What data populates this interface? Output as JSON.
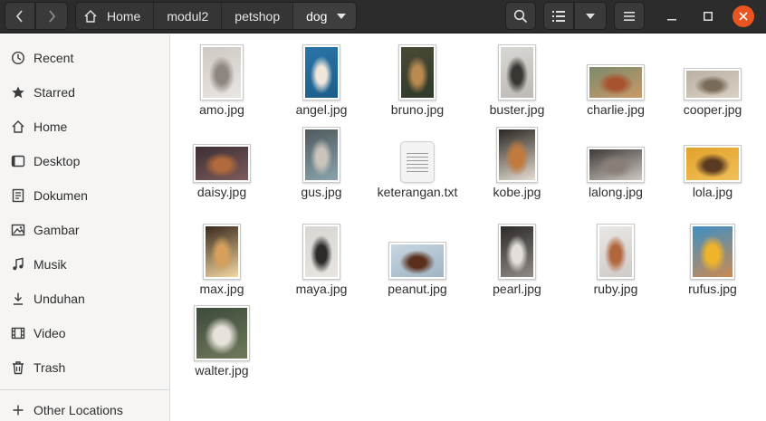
{
  "header": {
    "breadcrumbs": [
      "Home",
      "modul2",
      "petshop",
      "dog"
    ],
    "icons": {
      "back": "chevron-left-icon",
      "forward": "chevron-right-icon",
      "home": "home-icon",
      "dropdown": "chevron-down-icon",
      "search": "search-icon",
      "view": "list-view-icon",
      "menu": "hamburger-menu-icon",
      "minimize": "minimize-icon",
      "maximize": "maximize-icon",
      "close": "close-icon"
    },
    "close_color": "#e95420"
  },
  "sidebar": {
    "items": [
      {
        "label": "Recent",
        "icon": "clock-icon"
      },
      {
        "label": "Starred",
        "icon": "star-icon"
      },
      {
        "label": "Home",
        "icon": "home-icon"
      },
      {
        "label": "Desktop",
        "icon": "desktop-icon"
      },
      {
        "label": "Dokumen",
        "icon": "document-icon"
      },
      {
        "label": "Gambar",
        "icon": "image-icon"
      },
      {
        "label": "Musik",
        "icon": "music-icon"
      },
      {
        "label": "Unduhan",
        "icon": "download-icon"
      },
      {
        "label": "Video",
        "icon": "film-icon"
      },
      {
        "label": "Trash",
        "icon": "trash-icon"
      }
    ],
    "other_locations": {
      "label": "Other Locations",
      "icon": "plus-icon"
    }
  },
  "files": [
    {
      "name": "amo.jpg",
      "icon": "image-thumbnail",
      "colors": [
        "#cfc9c3",
        "#8e8580",
        "#eae6e2"
      ]
    },
    {
      "name": "angel.jpg",
      "icon": "image-thumbnail",
      "colors": [
        "#2a75a8",
        "#efe7dc",
        "#1c5d8a"
      ]
    },
    {
      "name": "bruno.jpg",
      "icon": "image-thumbnail",
      "colors": [
        "#4a4a36",
        "#b98a4f",
        "#2f3a2a"
      ]
    },
    {
      "name": "buster.jpg",
      "icon": "image-thumbnail",
      "colors": [
        "#d9d7d4",
        "#3a3634",
        "#bdb9b4"
      ]
    },
    {
      "name": "charlie.jpg",
      "icon": "image-thumbnail",
      "colors": [
        "#7b8a6b",
        "#a7532f",
        "#c99a6a"
      ]
    },
    {
      "name": "cooper.jpg",
      "icon": "image-thumbnail",
      "colors": [
        "#b9b1a3",
        "#7a6a58",
        "#d8d1c5"
      ]
    },
    {
      "name": "daisy.jpg",
      "icon": "image-thumbnail",
      "colors": [
        "#3b2f33",
        "#b06a3b",
        "#7d5b5b"
      ]
    },
    {
      "name": "gus.jpg",
      "icon": "image-thumbnail",
      "colors": [
        "#4f5a5d",
        "#c9c4bc",
        "#8aa3ad"
      ]
    },
    {
      "name": "keterangan.txt",
      "icon": "text-file-icon",
      "colors": []
    },
    {
      "name": "kobe.jpg",
      "icon": "image-thumbnail",
      "colors": [
        "#2b2622",
        "#c27a3c",
        "#e6ded3"
      ]
    },
    {
      "name": "lalong.jpg",
      "icon": "image-thumbnail",
      "colors": [
        "#3e3a38",
        "#8a7f78",
        "#cfc8c1"
      ]
    },
    {
      "name": "lola.jpg",
      "icon": "image-thumbnail",
      "colors": [
        "#e2a12a",
        "#5b3a22",
        "#f0c05a"
      ]
    },
    {
      "name": "max.jpg",
      "icon": "image-thumbnail",
      "colors": [
        "#3a2a1c",
        "#d6a05a",
        "#f3d7a3"
      ]
    },
    {
      "name": "maya.jpg",
      "icon": "image-thumbnail",
      "colors": [
        "#d8d6d2",
        "#2d2b2a",
        "#e9e6e1"
      ]
    },
    {
      "name": "peanut.jpg",
      "icon": "image-thumbnail",
      "colors": [
        "#c8d6e1",
        "#5c2f1c",
        "#9fb4c4"
      ]
    },
    {
      "name": "pearl.jpg",
      "icon": "image-thumbnail",
      "colors": [
        "#2e2a28",
        "#e3e0dc",
        "#8f8a86"
      ]
    },
    {
      "name": "ruby.jpg",
      "icon": "image-thumbnail",
      "colors": [
        "#e9e7e5",
        "#b1663d",
        "#cfcac6"
      ]
    },
    {
      "name": "rufus.jpg",
      "icon": "image-thumbnail",
      "colors": [
        "#3f8fc3",
        "#f0b42a",
        "#c98a55"
      ]
    },
    {
      "name": "walter.jpg",
      "icon": "image-thumbnail",
      "colors": [
        "#3d4a3a",
        "#e7e3dc",
        "#6f7a5c"
      ]
    }
  ]
}
